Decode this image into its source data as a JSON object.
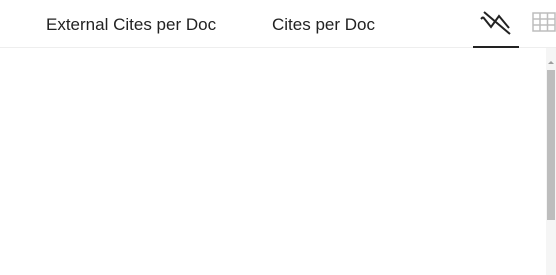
{
  "tabs": {
    "external_label": "External Cites per Doc",
    "cites_label": "Cites per Doc"
  },
  "view_toggle": {
    "chart_icon": "line-chart-icon",
    "table_icon": "table-grid-icon",
    "active": "chart"
  },
  "colors": {
    "text": "#222222",
    "icon_table": "#bdbdbd",
    "scroll_thumb": "#bdbdbd"
  }
}
